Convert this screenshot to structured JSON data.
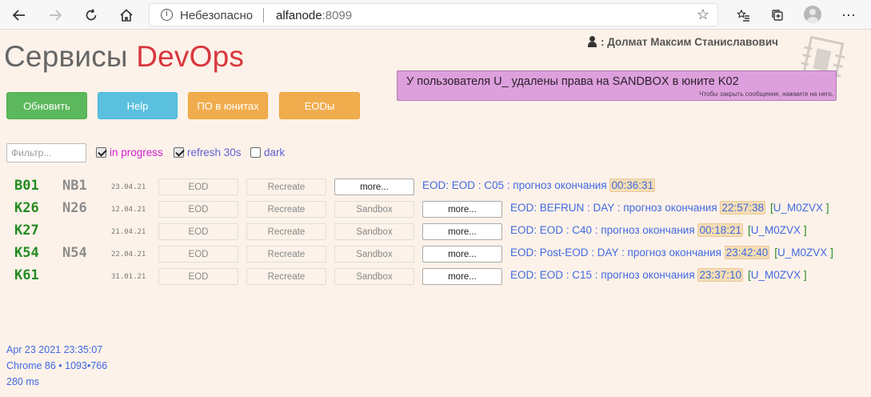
{
  "browser": {
    "security_text": "Небезопасно",
    "url_host": "alfanode",
    "url_port": ":8099"
  },
  "page": {
    "title_part1": "Сервисы",
    "title_part2": "DevOps",
    "user_name": ": Долмат Максим Станиславович",
    "notice_message": "У пользователя U_ удалены права на SANDBOX в юните K02",
    "notice_hint": "Чтобы закрыть сообщение, нажмите на него."
  },
  "toolbar": {
    "refresh": "Обновить",
    "help": "Help",
    "po": "ПО в юнитах",
    "eods": "EODы"
  },
  "filters": {
    "placeholder": "Фильтр...",
    "in_progress": "in progress",
    "in_progress_checked": true,
    "refresh30": "refresh 30s",
    "refresh30_checked": true,
    "dark": "dark",
    "dark_checked": false
  },
  "colors": {
    "in_progress_label": "#d020d0",
    "refresh_label": "#6060d0",
    "dark_label": "#6060d0"
  },
  "rows": [
    {
      "unit": "B01",
      "nb": "NB1",
      "date": "23.04.21",
      "eod": "EOD",
      "recreate": "Recreate",
      "more": "more...",
      "status": "EOD: EOD : C05 : прогноз окончания",
      "time": "00:36:31",
      "tag_open": "",
      "tag_code": "",
      "tag_close": ""
    },
    {
      "unit": "K26",
      "nb": "N26",
      "date": "12.04.21",
      "eod": "EOD",
      "recreate": "Recreate",
      "sandbox": "Sandbox",
      "more": "more...",
      "status": "EOD: BEFRUN : DAY : прогноз окончания",
      "time": "22:57:38",
      "tag_open": "[",
      "tag_code": "U_M0ZVX",
      "tag_close": "]"
    },
    {
      "unit": "K27",
      "nb": "",
      "date": "21.04.21",
      "eod": "EOD",
      "recreate": "Recreate",
      "sandbox": "Sandbox",
      "more": "more...",
      "status": "EOD: EOD : C40 : прогноз окончания",
      "time": "00:18:21",
      "tag_open": "[",
      "tag_code": "U_M0ZVX",
      "tag_close": "]"
    },
    {
      "unit": "K54",
      "nb": "N54",
      "date": "22.04.21",
      "eod": "EOD",
      "recreate": "Recreate",
      "sandbox": "Sandbox",
      "more": "more...",
      "status": "EOD: Post-EOD : DAY : прогноз окончания",
      "time": "23:42:40",
      "tag_open": "[",
      "tag_code": "U_M0ZVX",
      "tag_close": "]"
    },
    {
      "unit": "K61",
      "nb": "",
      "date": "31.01.21",
      "eod": "EOD",
      "recreate": "Recreate",
      "sandbox": "Sandbox",
      "more": "more...",
      "status": "EOD: EOD : C15 : прогноз окончания",
      "time": "23:37:10",
      "tag_open": "[",
      "tag_code": "U_M0ZVX",
      "tag_close": "]"
    }
  ],
  "footer": {
    "timestamp": "Apr 23 2021 23:35:07",
    "browser_info": "Chrome 86 • 1093•766",
    "timing": "280 ms"
  }
}
